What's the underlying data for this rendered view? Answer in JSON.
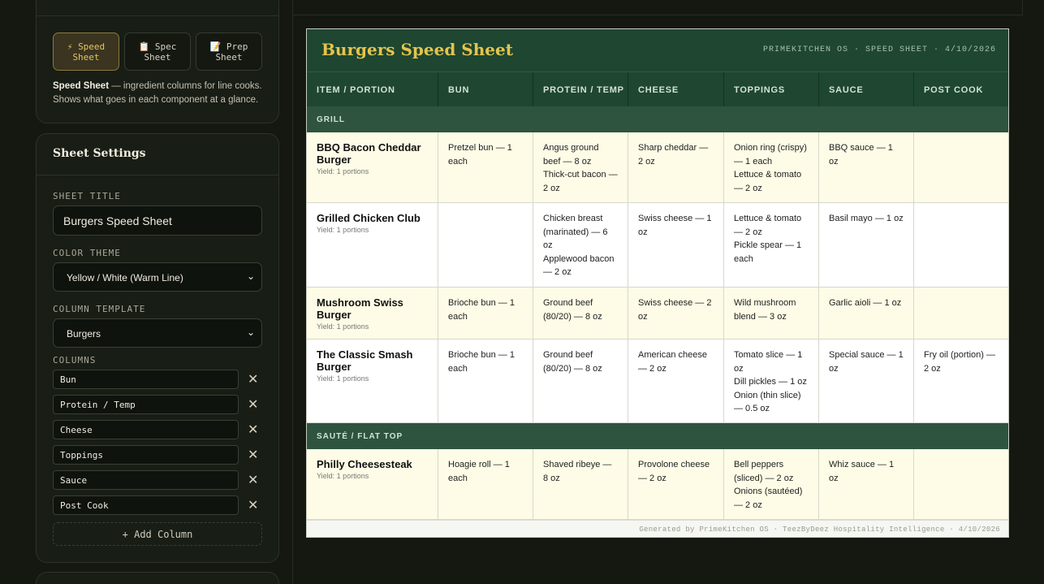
{
  "sidebar": {
    "tabs": [
      {
        "icon": "⚡",
        "line1": "Speed",
        "line2": "Sheet",
        "active": true
      },
      {
        "icon": "📋",
        "line1": "Spec",
        "line2": "Sheet",
        "active": false
      },
      {
        "icon": "📝",
        "line1": "Prep",
        "line2": "Sheet",
        "active": false
      }
    ],
    "tab_desc_bold": "Speed Sheet",
    "tab_desc_rest": " — ingredient columns for line cooks. Shows what goes in each component at a glance.",
    "settings": {
      "title": "Sheet Settings",
      "sheet_title_label": "SHEET TITLE",
      "sheet_title_value": "Burgers Speed Sheet",
      "color_theme_label": "COLOR THEME",
      "color_theme_value": "Yellow / White (Warm Line)",
      "column_template_label": "COLUMN TEMPLATE",
      "column_template_value": "Burgers",
      "columns_label": "COLUMNS",
      "columns": [
        "Bun",
        "Protein / Temp",
        "Cheese",
        "Toppings",
        "Sauce",
        "Post Cook"
      ],
      "add_column_label": "+ Add Column",
      "remove_glyph": "✕",
      "chevron_glyph": "⌄"
    }
  },
  "sheet": {
    "title": "Burgers Speed Sheet",
    "meta": "PRIMEKITCHEN OS · SPEED SHEET · 4/10/2026",
    "headers": [
      "ITEM / PORTION",
      "BUN",
      "PROTEIN / TEMP",
      "CHEESE",
      "TOPPINGS",
      "SAUCE",
      "POST COOK"
    ],
    "sections": [
      {
        "name": "GRILL",
        "rows": [
          {
            "name": "BBQ Bacon Cheddar Burger",
            "yield": "Yield: 1 portions",
            "cells": [
              [
                "Pretzel bun — 1 each"
              ],
              [
                "Angus ground beef — 8 oz",
                "Thick-cut bacon — 2 oz"
              ],
              [
                "Sharp cheddar — 2 oz"
              ],
              [
                "Onion ring (crispy) — 1 each",
                "Lettuce & tomato — 2 oz"
              ],
              [
                "BBQ sauce — 1 oz"
              ],
              []
            ]
          },
          {
            "name": "Grilled Chicken Club",
            "yield": "Yield: 1 portions",
            "cells": [
              [],
              [
                "Chicken breast (marinated) — 6 oz",
                "Applewood bacon — 2 oz"
              ],
              [
                "Swiss cheese — 1 oz"
              ],
              [
                "Lettuce & tomato — 2 oz",
                "Pickle spear — 1 each"
              ],
              [
                "Basil mayo — 1 oz"
              ],
              []
            ]
          },
          {
            "name": "Mushroom Swiss Burger",
            "yield": "Yield: 1 portions",
            "cells": [
              [
                "Brioche bun — 1 each"
              ],
              [
                "Ground beef (80/20) — 8 oz"
              ],
              [
                "Swiss cheese — 2 oz"
              ],
              [
                "Wild mushroom blend — 3 oz"
              ],
              [
                "Garlic aioli — 1 oz"
              ],
              []
            ]
          },
          {
            "name": "The Classic Smash Burger",
            "yield": "Yield: 1 portions",
            "cells": [
              [
                "Brioche bun — 1 each"
              ],
              [
                "Ground beef (80/20) — 8 oz"
              ],
              [
                "American cheese — 2 oz"
              ],
              [
                "Tomato slice — 1 oz",
                "Dill pickles — 1 oz",
                "Onion (thin slice) — 0.5 oz"
              ],
              [
                "Special sauce — 1 oz"
              ],
              [
                "Fry oil (portion) — 2 oz"
              ]
            ]
          }
        ]
      },
      {
        "name": "SAUTÉ / FLAT TOP",
        "rows": [
          {
            "name": "Philly Cheesesteak",
            "yield": "Yield: 1 portions",
            "cells": [
              [
                "Hoagie roll — 1 each"
              ],
              [
                "Shaved ribeye — 8 oz"
              ],
              [
                "Provolone cheese — 2 oz"
              ],
              [
                "Bell peppers (sliced) — 2 oz",
                "Onions (sautéed) — 2 oz"
              ],
              [
                "Whiz sauce — 1 oz"
              ],
              []
            ]
          }
        ]
      }
    ],
    "footer": "Generated by PrimeKitchen OS · TeezByDeez Hospitality Intelligence · 4/10/2026"
  }
}
